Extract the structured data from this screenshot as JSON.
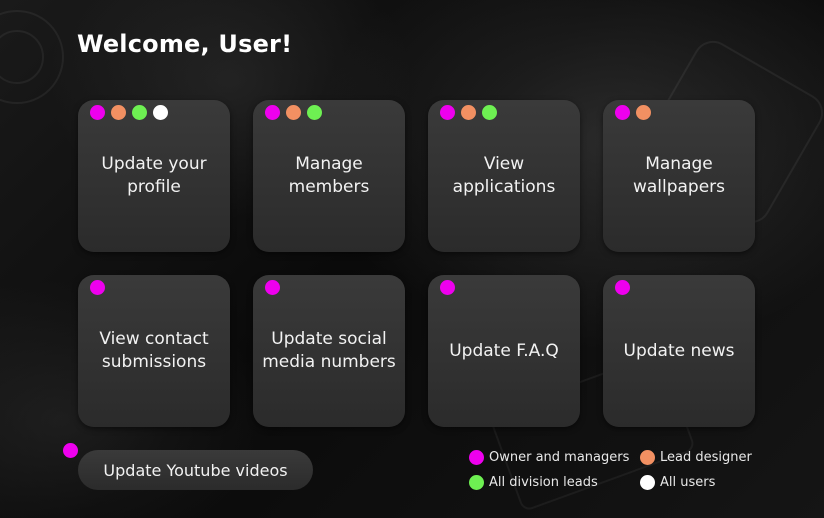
{
  "colors": {
    "owner": "#ee00ee",
    "lead_designer": "#f29062",
    "division_leads": "#6ef052",
    "all_users": "#ffffff"
  },
  "page": {
    "title": "Welcome, User!"
  },
  "cards": [
    {
      "label": "Update your\nprofile",
      "roles": [
        "owner",
        "lead_designer",
        "division_leads",
        "all_users"
      ]
    },
    {
      "label": "Manage\nmembers",
      "roles": [
        "owner",
        "lead_designer",
        "division_leads"
      ]
    },
    {
      "label": "View\napplications",
      "roles": [
        "owner",
        "lead_designer",
        "division_leads"
      ]
    },
    {
      "label": "Manage\nwallpapers",
      "roles": [
        "owner",
        "lead_designer"
      ]
    },
    {
      "label": "View contact\nsubmissions",
      "roles": [
        "owner"
      ]
    },
    {
      "label": "Update social\nmedia numbers",
      "roles": [
        "owner"
      ]
    },
    {
      "label": "Update F.A.Q",
      "roles": [
        "owner"
      ]
    },
    {
      "label": "Update news",
      "roles": [
        "owner"
      ]
    }
  ],
  "youtube_button": {
    "label": "Update Youtube videos",
    "roles": [
      "owner"
    ]
  },
  "legend": [
    {
      "role": "owner",
      "label": "Owner and managers"
    },
    {
      "role": "lead_designer",
      "label": "Lead designer"
    },
    {
      "role": "division_leads",
      "label": "All division leads"
    },
    {
      "role": "all_users",
      "label": "All users"
    }
  ]
}
